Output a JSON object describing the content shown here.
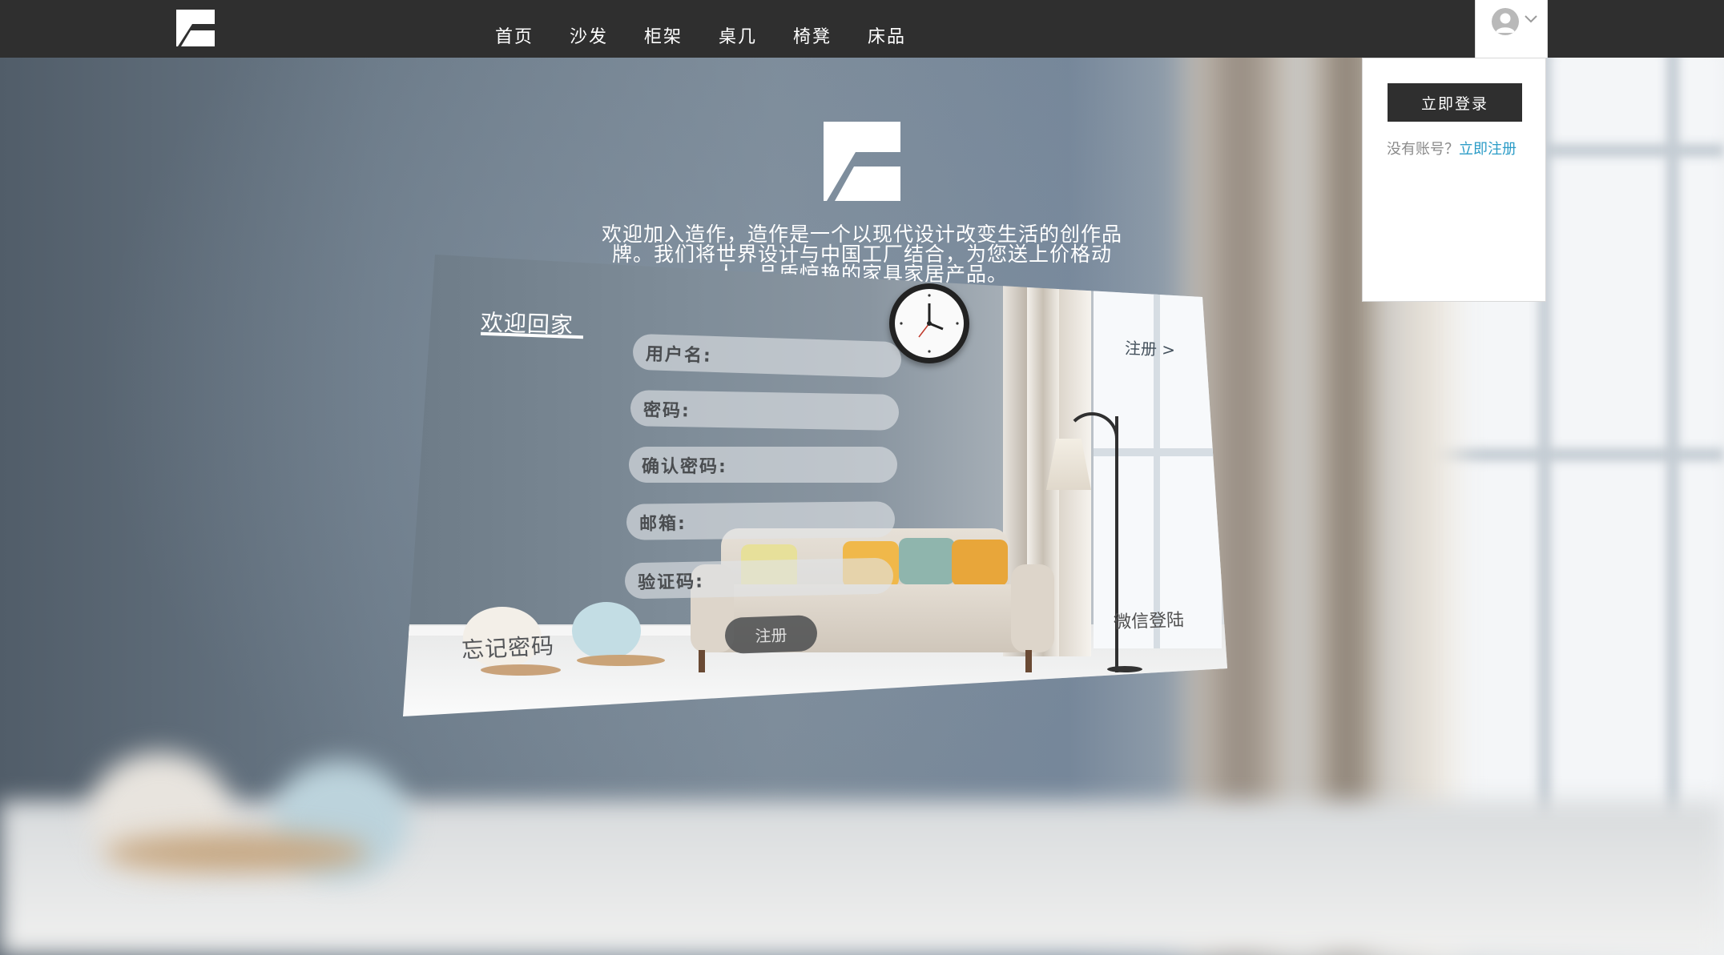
{
  "nav": {
    "links": [
      "首页",
      "沙发",
      "柜架",
      "桌几",
      "椅凳",
      "床品"
    ]
  },
  "user_menu": {
    "login_button": "立即登录",
    "no_account_text": "没有账号？",
    "register_link": "立即注册"
  },
  "hero": {
    "welcome_text": "欢迎加入造作，造作是一个以现代设计改变生活的创作品牌。我们将世界设计与中国工厂结合，为您送上价格动人、品质惊艳的家具家居产品。"
  },
  "register_card": {
    "title": "欢迎回家",
    "fields": [
      {
        "placeholder": "用户名:"
      },
      {
        "placeholder": "密码:"
      },
      {
        "placeholder": "确认密码:"
      },
      {
        "placeholder": "邮箱:"
      },
      {
        "placeholder": "验证码:"
      }
    ],
    "register_link": "注册 >",
    "forgot_password": "忘记密码",
    "submit_button": "注册",
    "wechat_login": "微信登陆"
  },
  "colors": {
    "navbar": "#2f2f2f",
    "link_accent": "#2b9cc7",
    "button_dark": "#2f2f2f"
  },
  "icons": [
    "brand-logo-icon",
    "user-avatar-icon",
    "chevron-down-icon",
    "wall-clock-icon"
  ]
}
